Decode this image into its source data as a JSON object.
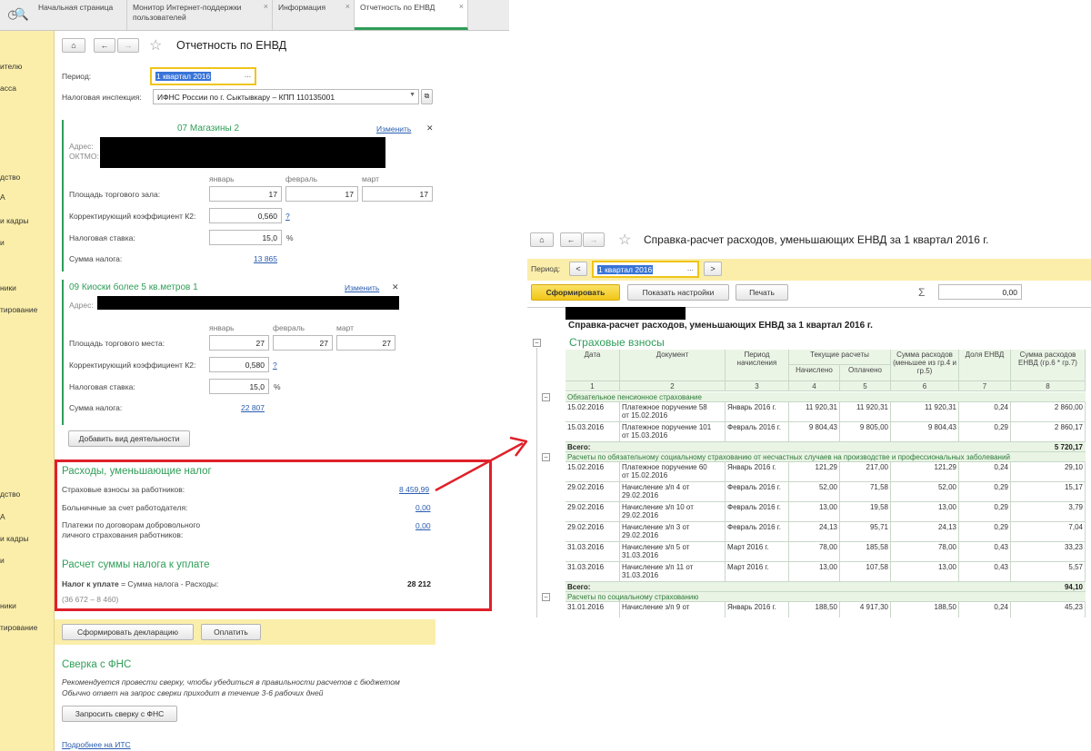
{
  "tabs": [
    {
      "label": "Начальная страница"
    },
    {
      "label": "Монитор Интернет-поддержки пользователей"
    },
    {
      "label": "Информация"
    },
    {
      "label": "Отчетность по ЕНВД"
    }
  ],
  "sidebar": {
    "items": [
      "ителю",
      "асса",
      "дство",
      "А",
      "и кадры",
      "и",
      "ники",
      "тирование",
      "дство",
      "А",
      "и кадры",
      "и",
      "ники",
      "тирование"
    ]
  },
  "left": {
    "title": "Отчетность по ЕНВД",
    "period_label": "Период:",
    "period_value": "1 квартал 2016",
    "inspection_label": "Налоговая инспекция:",
    "inspection_value": "ИФНС России по г. Сыктывкару – КПП 110135001",
    "ellipsis": "...",
    "activity1": {
      "name": "07 Магазины 2",
      "change": "Изменить",
      "address_label": "Адрес:",
      "oktmo_label": "ОКТМО:",
      "months": [
        "январь",
        "февраль",
        "март"
      ],
      "area_label": "Площадь торгового зала:",
      "area_values": [
        "17",
        "17",
        "17"
      ],
      "k2_label": "Корректирующий коэффициент К2:",
      "k2_value": "0,560",
      "q": "?",
      "rate_label": "Налоговая ставка:",
      "rate_value": "15,0",
      "pct": "%",
      "tax_label": "Сумма налога:",
      "tax_value": "13 865"
    },
    "activity2": {
      "name": "09 Киоски более 5 кв.метров 1",
      "change": "Изменить",
      "address_label": "Адрес:",
      "months": [
        "январь",
        "февраль",
        "март"
      ],
      "area_label": "Площадь торгового места:",
      "area_values": [
        "27",
        "27",
        "27"
      ],
      "k2_label": "Корректирующий коэффициент К2:",
      "k2_value": "0,580",
      "q": "?",
      "rate_label": "Налоговая ставка:",
      "rate_value": "15,0",
      "pct": "%",
      "tax_label": "Сумма налога:",
      "tax_value": "22 807"
    },
    "add_activity": "Добавить вид деятельности",
    "expenses": {
      "title": "Расходы, уменьшающие налог",
      "insurance_label": "Страховые взносы за работников:",
      "insurance_value": "8 459,99",
      "sick_label": "Больничные за счет работодателя:",
      "sick_value": "0,00",
      "voluntary_label1": "Платежи по договорам добровольного",
      "voluntary_label2": "личного страхования работников:",
      "voluntary_value": "0,00"
    },
    "calc": {
      "title": "Расчет суммы налога к уплате",
      "formula_bold": "Налог к уплате",
      "formula_rest": " = Сумма налога - Расходы:",
      "value": "28 212",
      "detail": "(36 672 – 8 460)"
    },
    "make_declaration": "Сформировать декларацию",
    "pay": "Оплатить",
    "fns": {
      "title": "Сверка с ФНС",
      "text1": "Рекомендуется провести сверку, чтобы убедиться в правильности расчетов с бюджетом",
      "text2": "Обычно ответ на запрос сверки приходит в течение 3-6 рабочих дней",
      "request": "Запросить сверку с ФНС",
      "more": "Подробнее на ИТС"
    }
  },
  "right": {
    "title": "Справка-расчет расходов, уменьшающих ЕНВД  за 1 квартал 2016 г.",
    "period_label": "Период:",
    "period_value": "1 квартал 2016",
    "ellipsis": "...",
    "generate": "Сформировать",
    "settings": "Показать настройки",
    "print": "Печать",
    "sigma": "Σ",
    "sum_value": "0,00",
    "report_title": "Справка-расчет расходов, уменьшающих ЕНВД  за 1 квартал 2016 г.",
    "section": "Страховые взносы",
    "headers": {
      "date": "Дата",
      "doc": "Документ",
      "period": "Период начисления",
      "current": "Текущие расчеты",
      "charged": "Начислено",
      "paid": "Оплачено",
      "sum_exp": "Сумма расходов (меньшее из гр.4 и гр.5)",
      "share": "Доля ЕНВД",
      "sum_envd": "Сумма расходов ЕНВД (гр.6 * гр.7)",
      "nums": [
        "1",
        "2",
        "3",
        "4",
        "5",
        "6",
        "7",
        "8"
      ]
    },
    "groups": [
      {
        "name": "Обязательное пенсионное страхование",
        "rows": [
          {
            "date": "15.02.2016",
            "doc1": "Платежное поручение 58",
            "doc2": "от 15.02.2016",
            "period": "Январь 2016 г.",
            "charged": "11 920,31",
            "paid": "11 920,31",
            "sum": "11 920,31",
            "share": "0,24",
            "envd": "2 860,00"
          },
          {
            "date": "15.03.2016",
            "doc1": "Платежное поручение 101",
            "doc2": "от 15.03.2016",
            "period": "Февраль 2016 г.",
            "charged": "9 804,43",
            "paid": "9 805,00",
            "sum": "9 804,43",
            "share": "0,29",
            "envd": "2 860,17"
          }
        ],
        "total_label": "Всего:",
        "total": "5 720,17"
      },
      {
        "name": "Расчеты по обязательному социальному страхованию от несчастных случаев на производстве и профессиональных заболеваний",
        "rows": [
          {
            "date": "15.02.2016",
            "doc1": "Платежное поручение 60",
            "doc2": "от 15.02.2016",
            "period": "Январь 2016 г.",
            "charged": "121,29",
            "paid": "217,00",
            "sum": "121,29",
            "share": "0,24",
            "envd": "29,10"
          },
          {
            "date": "29.02.2016",
            "doc1": "Начисление з/п 4 от",
            "doc2": "29.02.2016",
            "period": "Февраль 2016 г.",
            "charged": "52,00",
            "paid": "71,58",
            "sum": "52,00",
            "share": "0,29",
            "envd": "15,17"
          },
          {
            "date": "29.02.2016",
            "doc1": "Начисление з/п 10 от",
            "doc2": "29.02.2016",
            "period": "Февраль 2016 г.",
            "charged": "13,00",
            "paid": "19,58",
            "sum": "13,00",
            "share": "0,29",
            "envd": "3,79"
          },
          {
            "date": "29.02.2016",
            "doc1": "Начисление з/п 3 от",
            "doc2": "29.02.2016",
            "period": "Февраль 2016 г.",
            "charged": "24,13",
            "paid": "95,71",
            "sum": "24,13",
            "share": "0,29",
            "envd": "7,04"
          },
          {
            "date": "31.03.2016",
            "doc1": "Начисление з/п 5 от",
            "doc2": "31.03.2016",
            "period": "Март 2016 г.",
            "charged": "78,00",
            "paid": "185,58",
            "sum": "78,00",
            "share": "0,43",
            "envd": "33,23"
          },
          {
            "date": "31.03.2016",
            "doc1": "Начисление з/п 11 от",
            "doc2": "31.03.2016",
            "period": "Март 2016 г.",
            "charged": "13,00",
            "paid": "107,58",
            "sum": "13,00",
            "share": "0,43",
            "envd": "5,57"
          }
        ],
        "total_label": "Всего:",
        "total": "94,10"
      },
      {
        "name": "Расчеты по социальному страхованию",
        "rows": [
          {
            "date": "31.01.2016",
            "doc1": "Начисление з/п 9 от",
            "doc2": "",
            "period": "Январь 2016 г.",
            "charged": "188,50",
            "paid": "4 917,30",
            "sum": "188,50",
            "share": "0,24",
            "envd": "45,23"
          }
        ]
      }
    ]
  },
  "colors": {
    "accent": "#2e9e58",
    "highlight": "#e0202a",
    "panel": "#fbeeaa",
    "link": "#2a5db0"
  }
}
